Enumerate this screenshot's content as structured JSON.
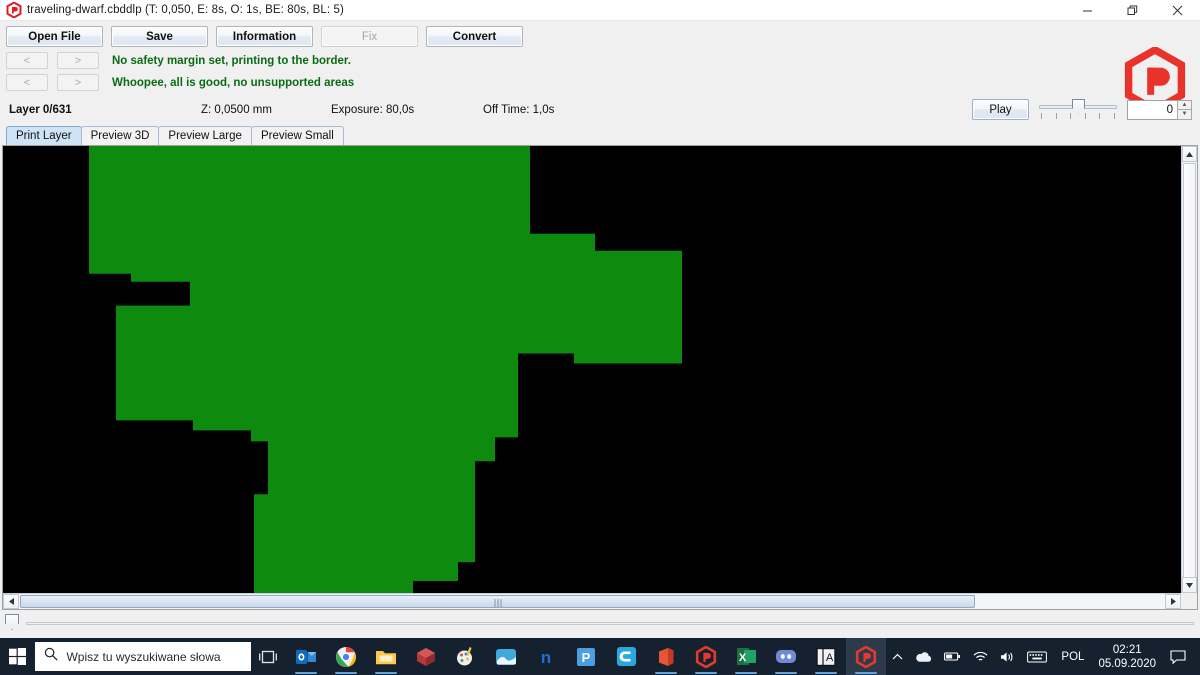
{
  "window": {
    "title": "traveling-dwarf.cbddlp (T: 0,050, E: 8s, O: 1s, BE: 80s, BL: 5)",
    "app_icon": "uvtools-logo-icon",
    "controls": {
      "minimize": "minimize-icon",
      "restore": "restore-icon",
      "close": "close-icon"
    }
  },
  "toolbar": {
    "open_file": "Open File",
    "save": "Save",
    "information": "Information",
    "fix": "Fix",
    "convert": "Convert",
    "fix_disabled": true
  },
  "navigation": {
    "prev": "<",
    "next": ">",
    "rows": [
      {
        "prev": "<",
        "next": ">",
        "message": "No safety margin set, printing to the border."
      },
      {
        "prev": "<",
        "next": ">",
        "message": "Whoopee, all is good, no unsupported areas"
      }
    ],
    "message_color": "#0b6b15"
  },
  "info": {
    "layer": "Layer 0/631",
    "z": "Z: 0,0500 mm",
    "exposure": "Exposure: 80,0s",
    "off_time": "Off Time: 1,0s"
  },
  "playback": {
    "play_label": "Play",
    "slider_value": 50,
    "spinner_value": "0",
    "spin_up": "▲",
    "spin_down": "▼"
  },
  "tabs": [
    {
      "label": "Print Layer",
      "active": true
    },
    {
      "label": "Preview 3D",
      "active": false
    },
    {
      "label": "Preview Large",
      "active": false
    },
    {
      "label": "Preview Small",
      "active": false
    }
  ],
  "viewport": {
    "background_color": "#000000",
    "layer_color": "#0e8a0e",
    "layer_index": 0,
    "layer_total": 631
  },
  "scrollbars": {
    "horizontal_thumb_percent": 81,
    "vertical_thumb_percent": 96,
    "left_arrow": "◀",
    "right_arrow": "▶",
    "up_arrow": "▲",
    "down_arrow": "▼"
  },
  "layer_slider": {
    "value": 0
  },
  "taskbar": {
    "start": "windows-start-icon",
    "search_placeholder": "Wpisz tu wyszukiwane słowa",
    "search_icon": "search-icon",
    "task_view": "task-view-icon",
    "apps": [
      {
        "name": "outlook",
        "letter": "O",
        "color": "#0f6cbd",
        "running": true
      },
      {
        "name": "chrome",
        "letter": "",
        "color": "#f8f8f8",
        "running": true
      },
      {
        "name": "file-explorer",
        "letter": "",
        "color": "#ffc848",
        "running": true
      },
      {
        "name": "3d-viewer",
        "letter": "",
        "color": "#b33a3a",
        "running": false
      },
      {
        "name": "paint-3d",
        "letter": "",
        "color": "#e8b73a",
        "running": false
      },
      {
        "name": "photos",
        "letter": "",
        "color": "#3fa9dd",
        "running": false
      },
      {
        "name": "nahimic",
        "letter": "n",
        "color": "#1f6fd0",
        "running": false
      },
      {
        "name": "powerpoint-blue",
        "letter": "P",
        "color": "#4a9fe0",
        "running": false
      },
      {
        "name": "chitubox",
        "letter": "C",
        "color": "#29a8e0",
        "running": false
      },
      {
        "name": "office",
        "letter": "",
        "color": "#e8543a",
        "running": true
      },
      {
        "name": "uvtools",
        "letter": "P",
        "color": "#e23a2e",
        "running": true
      },
      {
        "name": "excel",
        "letter": "X",
        "color": "#1d7044",
        "running": true
      },
      {
        "name": "discord",
        "letter": "",
        "color": "#7289da",
        "running": true
      },
      {
        "name": "text-tool",
        "letter": "A",
        "color": "#f0f0f0",
        "running": true
      },
      {
        "name": "uvtools-active",
        "letter": "P",
        "color": "#e23a2e",
        "running": true,
        "active": true
      }
    ],
    "tray": {
      "chevron": "show-hidden-icons",
      "onedrive": "onedrive-icon",
      "battery": "battery-icon",
      "network": "wifi-icon",
      "volume": "speaker-icon",
      "keyboard": "keyboard-icon",
      "language": "POL",
      "time": "02:21",
      "date": "05.09.2020",
      "action_center": "notification-icon"
    }
  }
}
